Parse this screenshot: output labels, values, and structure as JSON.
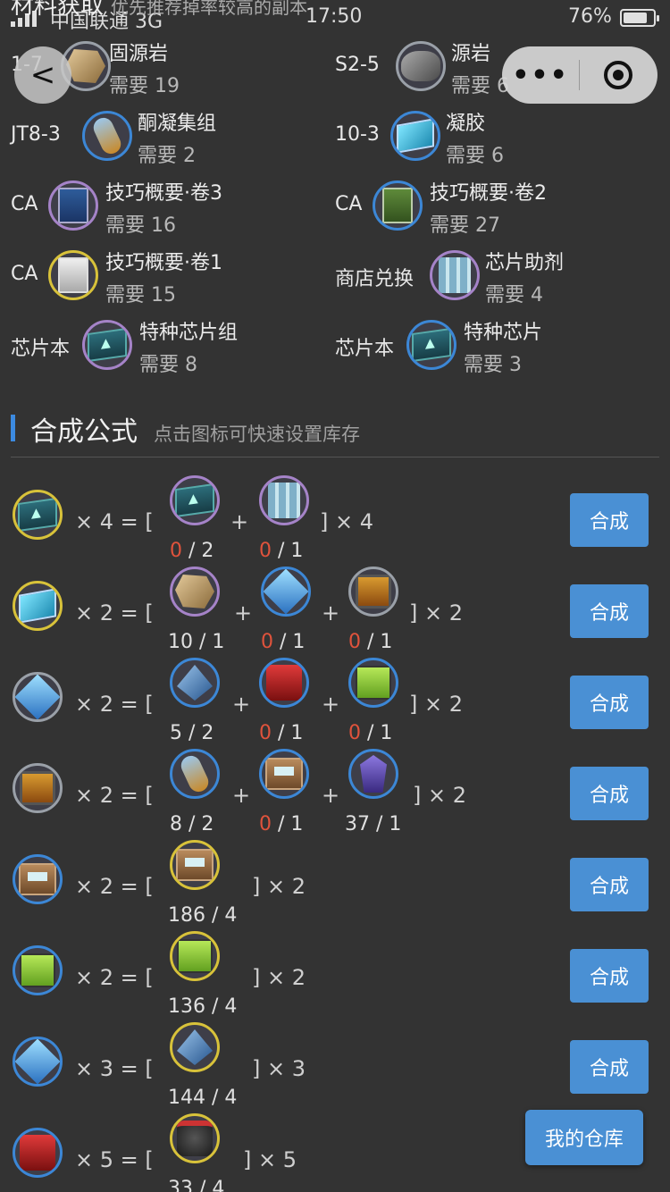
{
  "status_bar": {
    "carrier": "中国联通  3G",
    "time": "17:50",
    "battery": "76%"
  },
  "header": {
    "title": "材料获取",
    "subtitle": "优先推荐掉率较高的副本"
  },
  "requirements": [
    {
      "stage": "1-7",
      "name": "固源岩",
      "need": "需要 19",
      "icon": "rock-icon"
    },
    {
      "stage": "S2-5",
      "name": "源岩",
      "need": "需要 6",
      "icon": "stone-icon"
    },
    {
      "stage": "JT8-3",
      "name": "酮凝集组",
      "need": "需要 2",
      "icon": "flask-icon"
    },
    {
      "stage": "10-3",
      "name": "凝胶",
      "need": "需要 6",
      "icon": "crystal-icon"
    },
    {
      "stage": "CA",
      "name": "技巧概要·卷3",
      "need": "需要 16",
      "icon": "book-icon"
    },
    {
      "stage": "CA",
      "name": "技巧概要·卷2",
      "need": "需要 27",
      "icon": "book-icon"
    },
    {
      "stage": "CA",
      "name": "技巧概要·卷1",
      "need": "需要 15",
      "icon": "book-icon"
    },
    {
      "stage": "商店兑换",
      "name": "芯片助剂",
      "need": "需要 4",
      "icon": "vials-icon"
    },
    {
      "stage": "芯片本",
      "name": "特种芯片组",
      "need": "需要 8",
      "icon": "chip-icon"
    },
    {
      "stage": "芯片本",
      "name": "特种芯片",
      "need": "需要 3",
      "icon": "chip-icon"
    }
  ],
  "section": {
    "title": "合成公式",
    "hint": "点击图标可快速设置库存"
  },
  "craft_label": "合成",
  "warehouse_label": "我的仓库",
  "formulas": [
    {
      "mult": "× 4 = [",
      "tail": "] × 4",
      "ingredients": [
        {
          "have": "0",
          "need": " / 2",
          "short": true
        },
        {
          "have": "0",
          "need": " / 1",
          "short": true
        }
      ]
    },
    {
      "mult": "× 2 = [",
      "tail": "] × 2",
      "ingredients": [
        {
          "have": "10",
          "need": " / 1",
          "short": false
        },
        {
          "have": "0",
          "need": " / 1",
          "short": true
        },
        {
          "have": "0",
          "need": " / 1",
          "short": true
        }
      ]
    },
    {
      "mult": "× 2 = [",
      "tail": "] × 2",
      "ingredients": [
        {
          "have": "5",
          "need": " / 2",
          "short": false
        },
        {
          "have": "0",
          "need": " / 1",
          "short": true
        },
        {
          "have": "0",
          "need": " / 1",
          "short": true
        }
      ]
    },
    {
      "mult": "× 2 = [",
      "tail": "] × 2",
      "ingredients": [
        {
          "have": "8",
          "need": " / 2",
          "short": false
        },
        {
          "have": "0",
          "need": " / 1",
          "short": true
        },
        {
          "have": "37",
          "need": " / 1",
          "short": false
        }
      ]
    },
    {
      "mult": "× 2 = [",
      "tail": "] × 2",
      "ingredients": [
        {
          "have": "186",
          "need": " / 4",
          "short": false
        }
      ]
    },
    {
      "mult": "× 2 = [",
      "tail": "] × 2",
      "ingredients": [
        {
          "have": "136",
          "need": " / 4",
          "short": false
        }
      ]
    },
    {
      "mult": "× 3 = [",
      "tail": "] × 3",
      "ingredients": [
        {
          "have": "144",
          "need": " / 4",
          "short": false
        }
      ]
    },
    {
      "mult": "× 5 = [",
      "tail": "] × 5",
      "ingredients": [
        {
          "have": "33",
          "need": " / 4",
          "short": false
        }
      ]
    }
  ],
  "colors": {
    "background": "#333333",
    "accent": "#4a90d4",
    "shortage": "#e0533c"
  }
}
